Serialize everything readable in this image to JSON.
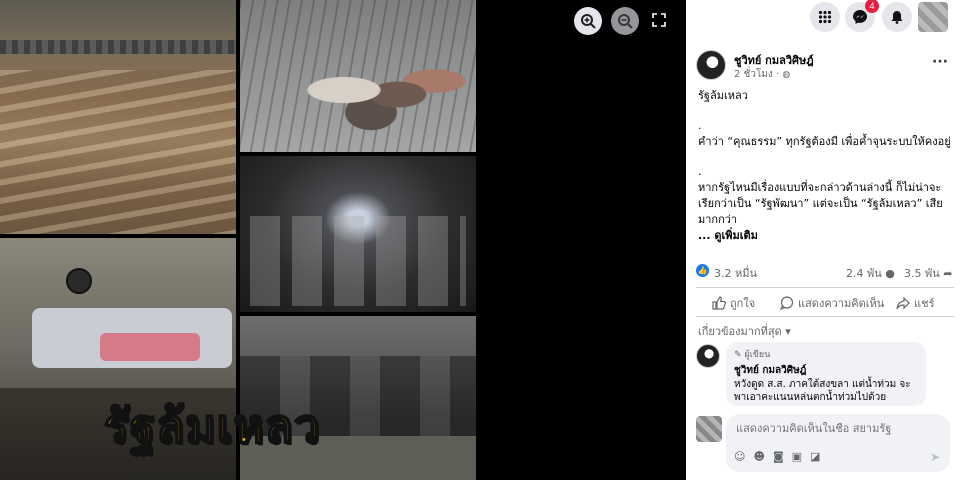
{
  "viewer": {
    "overlay_text": "รัฐล้มเหลว",
    "zoom_in_icon": "zoom-in-icon",
    "zoom_out_icon": "zoom-out-icon",
    "fullscreen_icon": "fullscreen-icon"
  },
  "topbar": {
    "messenger_badge": "4"
  },
  "post": {
    "author": "ชูวิทย์ กมลวิศิษฎ์",
    "time": "2 ชั่วโมง",
    "more": "···",
    "body": [
      "รัฐล้มเหลว",
      ".",
      "คำว่า “คุณธรรม” ทุกรัฐต้องมี เพื่อค้ำจุนระบบให้คงอยู่",
      ".",
      "หากรัฐไหนมีเรื่องแบบที่จะกล่าวด้านล่างนี้ ก็ไม่น่าจะเรียกว่าเป็น “รัฐพัฒนา” แต่จะเป็น “รัฐล้มเหลว” เสียมากกว่า"
    ],
    "see_more": "... ดูเพิ่มเติม",
    "reactions_count": "3.2 หมื่น",
    "comments_count": "2.4 พัน",
    "shares_count": "3.5 พัน",
    "actions": {
      "like": "ถูกใจ",
      "comment": "แสดงความคิดเห็น",
      "share": "แชร์"
    },
    "relevance": "เกี่ยวข้องมากที่สุด ▾"
  },
  "comment": {
    "role": "ผู้เขียน",
    "name": "ชูวิทย์ กมลวิศิษฎ์",
    "text": "หวังดูด ส.ส. ภาคใต้สงขลา แต่น้ำท่วม จะพาเอาคะแนนหล่นตกน้ำท่วมไปด้วย"
  },
  "composer": {
    "placeholder": "แสดงความคิดเห็นในชื่อ สยามรัฐ"
  }
}
